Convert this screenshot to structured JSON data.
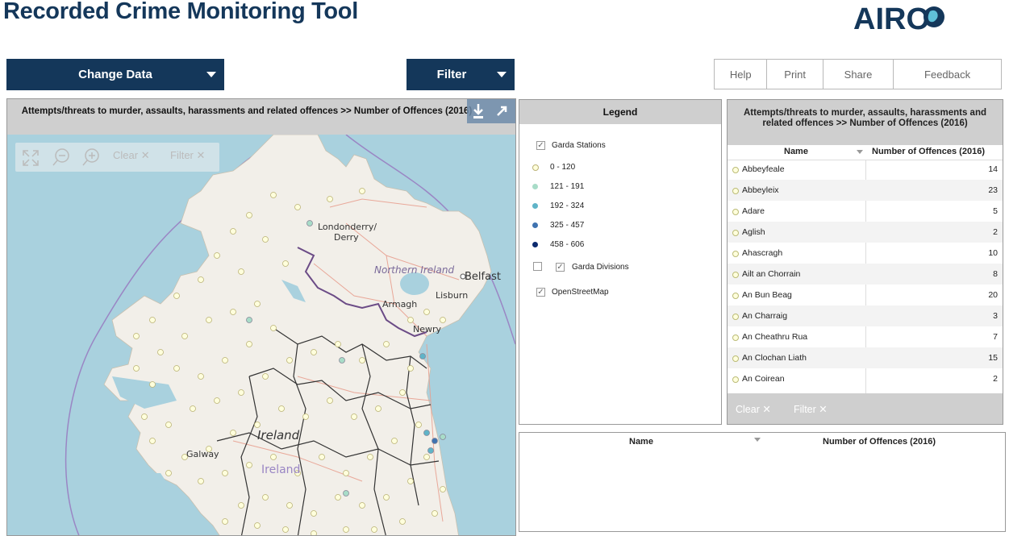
{
  "header": {
    "title": "Recorded Crime Monitoring Tool",
    "logo_text": "AIRO"
  },
  "controls": {
    "change_data": "Change Data",
    "filter": "Filter"
  },
  "topnav": [
    "Help",
    "Print",
    "Share",
    "Feedback"
  ],
  "map": {
    "title": "Attempts/threats to murder, assaults, harassments and related offences >>  Number of Offences (2016)",
    "toolbar": {
      "clear": "Clear",
      "filter": "Filter"
    },
    "labels": {
      "derry": "Londonderry/",
      "derry2": "Derry",
      "ni": "Northern Ireland",
      "belfast": "Belfast",
      "armagh": "Armagh",
      "lisburn": "Lisburn",
      "newry": "Newry",
      "ireland1": "Ireland",
      "ireland2": "Ireland",
      "galway": "Galway"
    },
    "colors": {
      "sea": "#a9d1de",
      "land": "#f2efe9",
      "border": "#6b4b86"
    }
  },
  "legend": {
    "title": "Legend",
    "garda_stations": "Garda Stations",
    "classes": [
      {
        "label": "0 - 120",
        "color": "#ffffdc"
      },
      {
        "label": "121 - 191",
        "color": "#a8dcc8"
      },
      {
        "label": "192 - 324",
        "color": "#5fb4c8"
      },
      {
        "label": "325 - 457",
        "color": "#3f73b0"
      },
      {
        "label": "458 - 606",
        "color": "#0c2a6e"
      }
    ],
    "garda_divisions": "Garda Divisions",
    "osm": "OpenStreetMap"
  },
  "table": {
    "title": "Attempts/threats to murder, assaults, harassments and related offences >>  Number of Offences (2016)",
    "col_name": "Name",
    "col_value": "Number of Offences (2016)",
    "rows": [
      {
        "name": "Abbeyfeale",
        "value": "14"
      },
      {
        "name": "Abbeyleix",
        "value": "23"
      },
      {
        "name": "Adare",
        "value": "5"
      },
      {
        "name": "Aglish",
        "value": "2"
      },
      {
        "name": "Ahascragh",
        "value": "10"
      },
      {
        "name": "Ailt an Chorrain",
        "value": "8"
      },
      {
        "name": "An Bun Beag",
        "value": "20"
      },
      {
        "name": "An Charraig",
        "value": "3"
      },
      {
        "name": "An Cheathru Rua",
        "value": "7"
      },
      {
        "name": "An Clochan Liath",
        "value": "15"
      },
      {
        "name": "An Coirean",
        "value": "2"
      }
    ],
    "footer": {
      "clear": "Clear",
      "filter": "Filter"
    }
  },
  "bottom_table": {
    "col_name": "Name",
    "col_value": "Number of Offences (2016)"
  }
}
